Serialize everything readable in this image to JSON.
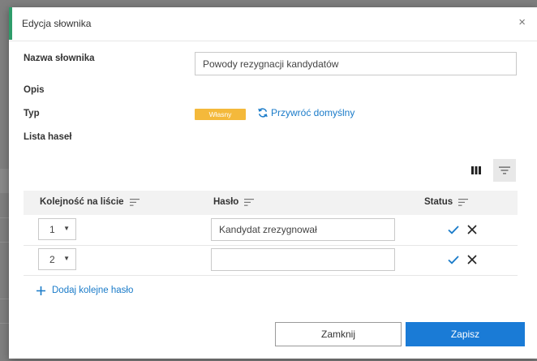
{
  "dialog": {
    "title": "Edycja słownika",
    "close_icon": "close-icon"
  },
  "form": {
    "name_label": "Nazwa słownika",
    "name_value": "Powody rezygnacji kandydatów",
    "description_label": "Opis",
    "type_label": "Typ",
    "type_badge": "Własny",
    "restore_link": "Przywróć domyślny",
    "list_label": "Lista haseł"
  },
  "toolbar": {
    "columns_icon": "columns-icon",
    "filter_icon": "filter-icon"
  },
  "table": {
    "headers": {
      "order": "Kolejność na liście",
      "password": "Hasło",
      "status": "Status"
    },
    "rows": [
      {
        "order": "1",
        "value": "Kandydat zrezygnował",
        "placeholder": ""
      },
      {
        "order": "2",
        "value": "",
        "placeholder": ""
      }
    ]
  },
  "add_link": "Dodaj kolejne hasło",
  "buttons": {
    "cancel": "Zamknij",
    "save": "Zapisz"
  },
  "colors": {
    "accent": "#2e9c6a",
    "primary": "#1a7bd6",
    "badge": "#f4b93b",
    "link": "#1a7bc9"
  }
}
